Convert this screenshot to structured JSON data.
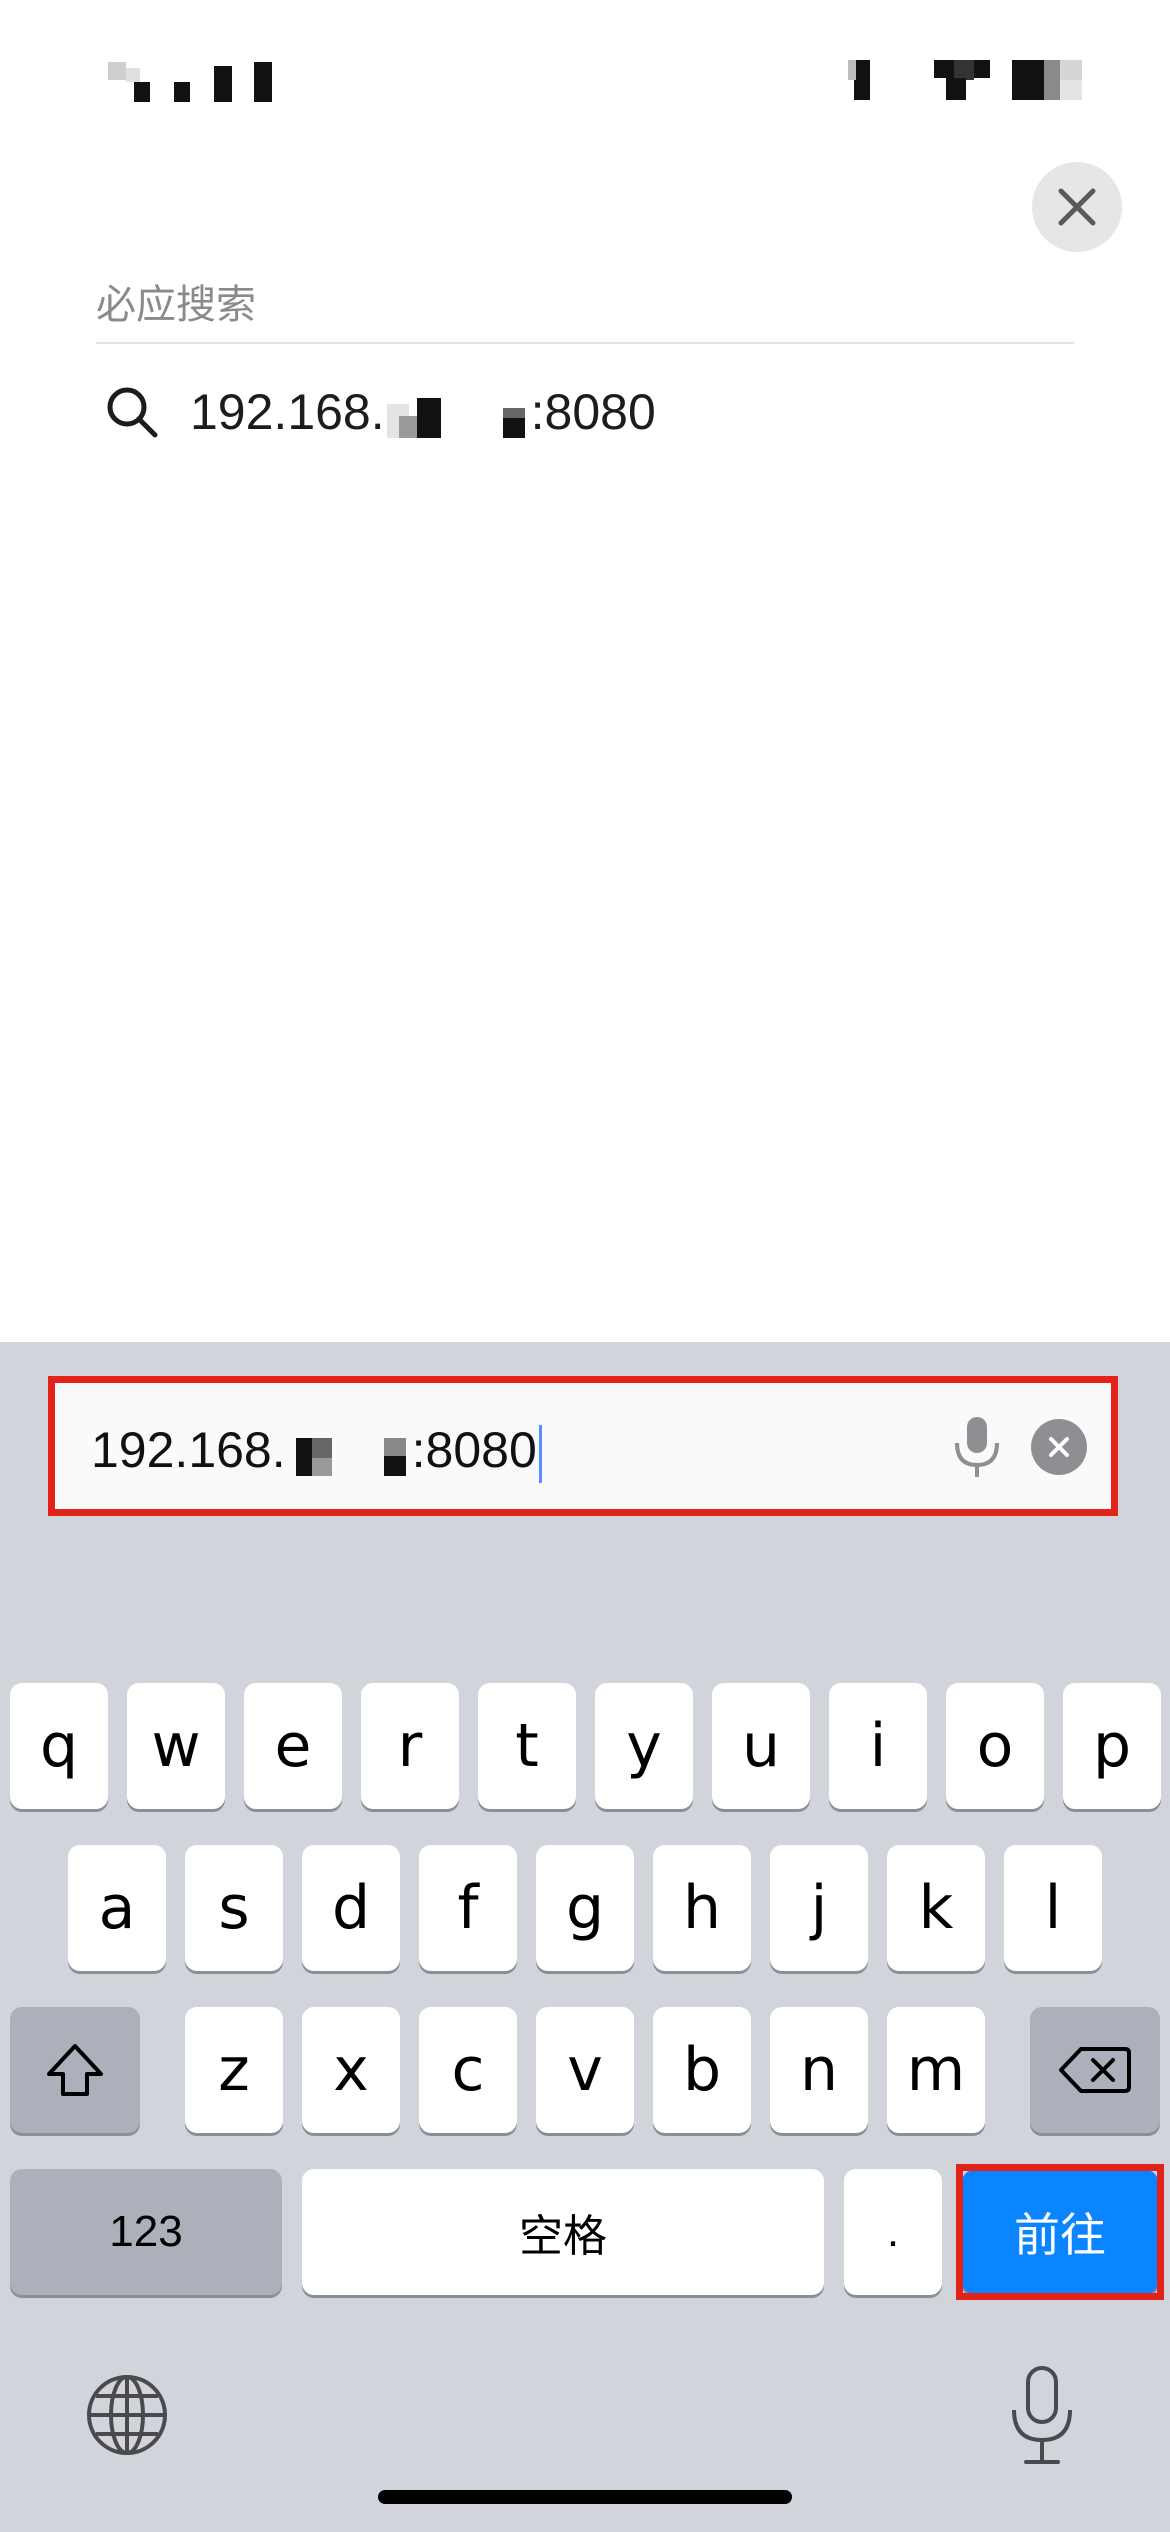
{
  "search_panel": {
    "section_title": "必应搜索",
    "suggestion_prefix": "192.168.",
    "suggestion_suffix": ":8080"
  },
  "address_bar": {
    "value_prefix": "192.168.",
    "value_suffix": ":8080"
  },
  "keyboard": {
    "row1": [
      "q",
      "w",
      "e",
      "r",
      "t",
      "y",
      "u",
      "i",
      "o",
      "p"
    ],
    "row2": [
      "a",
      "s",
      "d",
      "f",
      "g",
      "h",
      "j",
      "k",
      "l"
    ],
    "row3": [
      "z",
      "x",
      "c",
      "v",
      "b",
      "n",
      "m"
    ],
    "numbers_label": "123",
    "space_label": "空格",
    "period_label": ".",
    "go_label": "前往"
  },
  "colors": {
    "accent": "#0a84ff",
    "highlight_outline": "#e2231a",
    "keyboard_bg": "#d1d4db"
  },
  "icons": {
    "close": "close-icon",
    "search": "search-icon",
    "microphone": "microphone-icon",
    "clear": "clear-icon",
    "shift": "shift-icon",
    "backspace": "backspace-icon",
    "globe": "globe-icon"
  }
}
